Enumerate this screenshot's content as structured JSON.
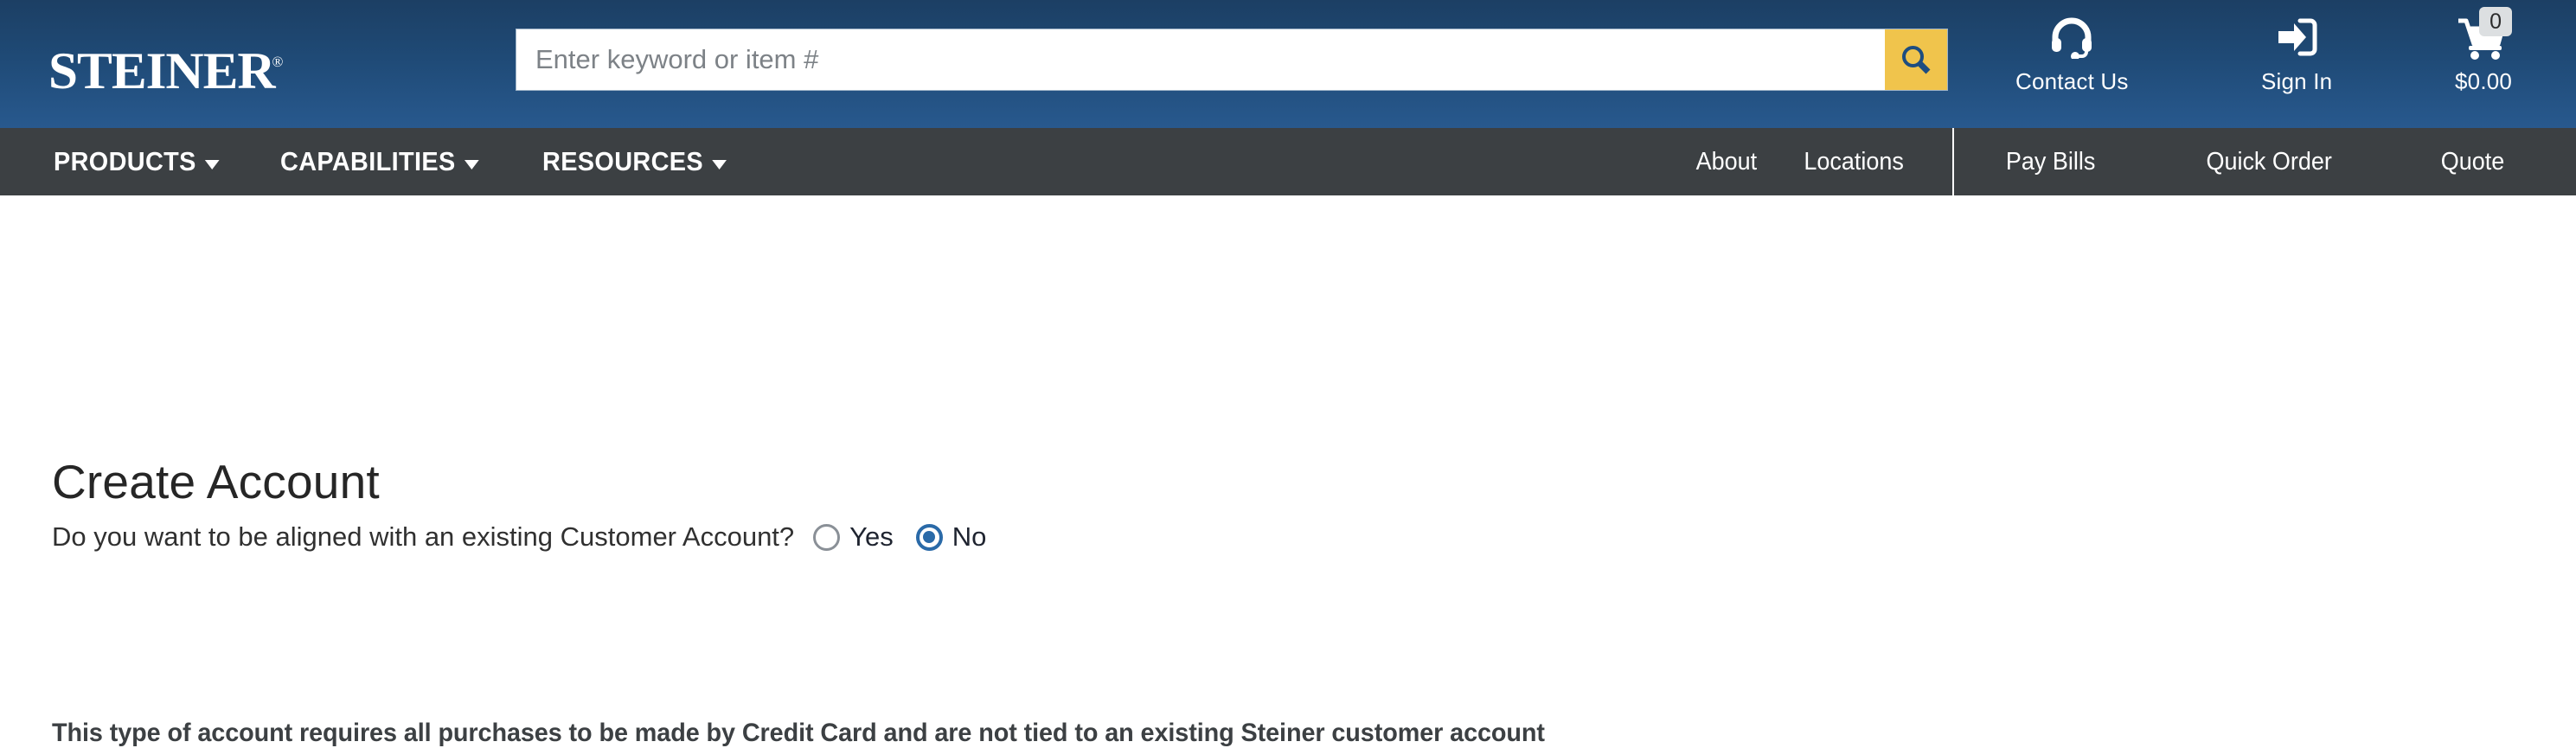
{
  "header": {
    "logo_text": "Steiner",
    "logo_registered": "®",
    "search": {
      "placeholder": "Enter keyword or item #",
      "value": "",
      "button_icon": "search-icon"
    },
    "utilities": [
      {
        "id": "contact",
        "label": "Contact Us",
        "icon": "headset-icon"
      },
      {
        "id": "signin",
        "label": "Sign In",
        "icon": "login-arrow-icon"
      },
      {
        "id": "cart",
        "label": "$0.00",
        "icon": "shopping-cart-icon",
        "badge": "0"
      }
    ]
  },
  "nav": {
    "main_items": [
      {
        "label": "PRODUCTS",
        "icon": "chevron-down-icon"
      },
      {
        "label": "CAPABILITIES",
        "icon": "chevron-down-icon"
      },
      {
        "label": "RESOURCES",
        "icon": "chevron-down-icon"
      }
    ],
    "secondary_items": [
      {
        "label": "About"
      },
      {
        "label": "Locations"
      }
    ],
    "action_items": [
      {
        "label": "Pay Bills"
      },
      {
        "label": "Quick Order"
      },
      {
        "label": "Quote"
      }
    ]
  },
  "main": {
    "title": "Create Account",
    "align_question": "Do you want to be aligned with an existing Customer Account?",
    "radio_options": [
      {
        "label": "Yes",
        "selected": false
      },
      {
        "label": "No",
        "selected": true
      }
    ],
    "notice": "This type of account requires all purchases to be made by Credit Card and are not tied to an existing Steiner customer account"
  },
  "colors": {
    "header_top": "#1c3f64",
    "header_bottom": "#28598e",
    "nav_bar": "#3c4043",
    "search_button": "#f0c44c",
    "accent_blue": "#2a6aa8",
    "text_dark": "#3c4043"
  }
}
